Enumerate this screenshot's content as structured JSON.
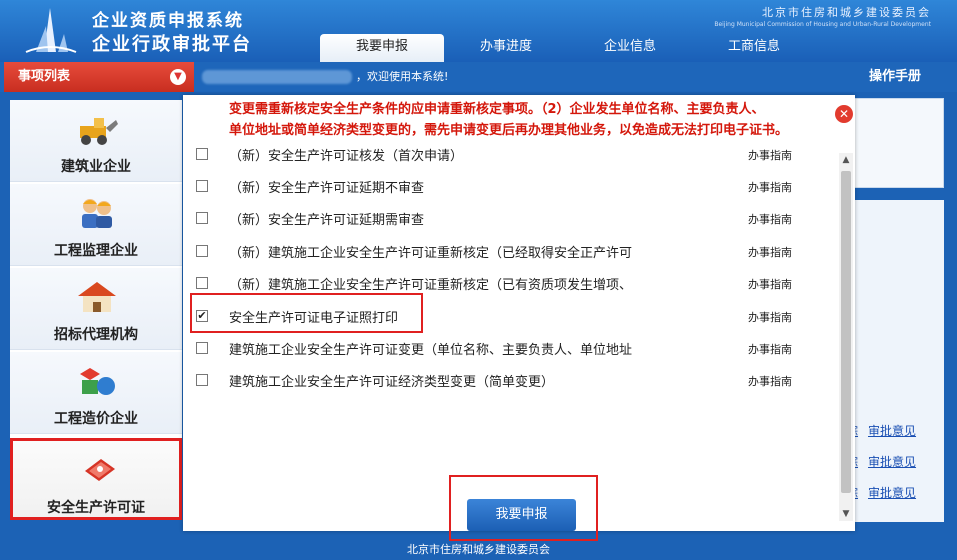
{
  "header": {
    "title_line1": "企业资质申报系统",
    "title_line2": "企业行政审批平台",
    "commission_zh": "北京市住房和城乡建设委员会",
    "commission_en": "Beijing Municipal Commission of Housing and Urban-Rural Development"
  },
  "nav": {
    "tabs": [
      "我要申报",
      "办事进度",
      "企业信息",
      "工商信息"
    ],
    "active": "我要申报"
  },
  "subbar": {
    "menu_label": "事项列表",
    "welcome": "，欢迎使用本系统!",
    "manual": "操作手册"
  },
  "sidebar": {
    "items": [
      {
        "label": "建筑业企业",
        "icon": "construction-vehicle-icon"
      },
      {
        "label": "工程监理企业",
        "icon": "workers-icon"
      },
      {
        "label": "招标代理机构",
        "icon": "house-icon"
      },
      {
        "label": "工程造价企业",
        "icon": "blocks-icon"
      },
      {
        "label": "安全生产许可证",
        "icon": "certificate-icon"
      }
    ]
  },
  "modal": {
    "note_line1": "变更需重新核定安全生产条件的应申请重新核定事项。（2）企业发生单位名称、主要负责人、",
    "note_line2": "单位地址或简单经济类型变更的，需先申请变更后再办理其他业务，以免造成无法打印电子证书。",
    "items": [
      {
        "label": "（新）安全生产许可证核发（首次申请）",
        "guide": "办事指南",
        "checked": false
      },
      {
        "label": "（新）安全生产许可证延期不审查",
        "guide": "办事指南",
        "checked": false
      },
      {
        "label": "（新）安全生产许可证延期需审查",
        "guide": "办事指南",
        "checked": false
      },
      {
        "label": "（新）建筑施工企业安全生产许可证重新核定（已经取得安全正产许可",
        "guide": "办事指南",
        "checked": false
      },
      {
        "label": "（新）建筑施工企业安全生产许可证重新核定（已有资质项发生增项、",
        "guide": "办事指南",
        "checked": false
      },
      {
        "label": "安全生产许可证电子证照打印",
        "guide": "办事指南",
        "checked": true
      },
      {
        "label": "建筑施工企业安全生产许可证变更（单位名称、主要负责人、单位地址",
        "guide": "办事指南",
        "checked": false
      },
      {
        "label": "建筑施工企业安全生产许可证经济类型变更（简单变更）",
        "guide": "办事指南",
        "checked": false
      }
    ],
    "submit_label": "我要申报"
  },
  "background_links": {
    "track_fragment": "踪",
    "opinion": "审批意见"
  },
  "footer": {
    "text": "北京市住房和城乡建设委员会"
  },
  "colors": {
    "brand_blue": "#1c62b5",
    "accent_red": "#e02020",
    "note_red": "#d4170b"
  }
}
